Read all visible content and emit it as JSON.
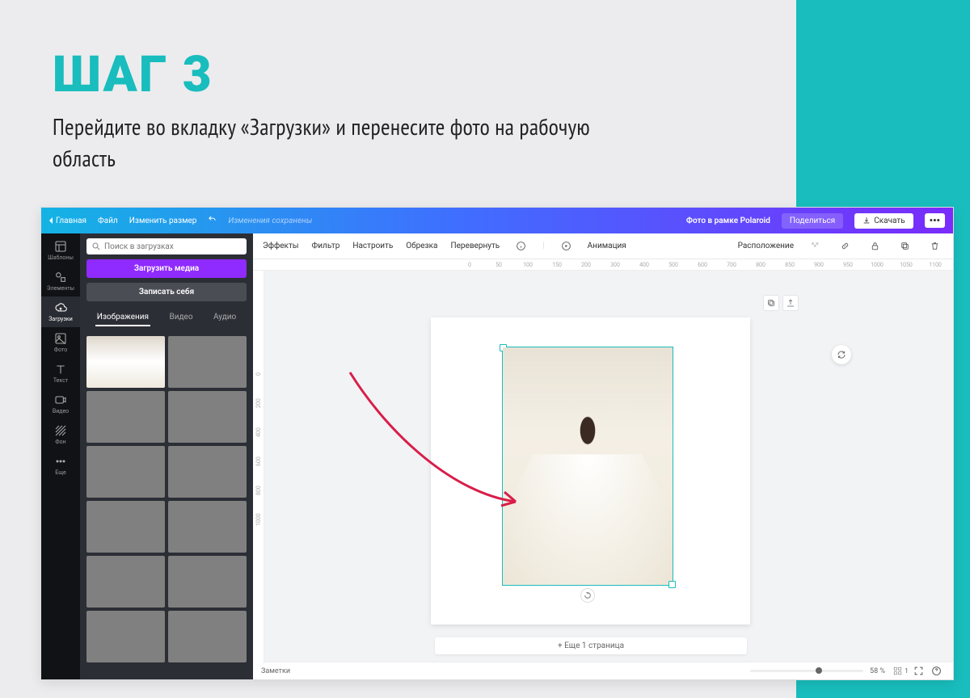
{
  "step": {
    "title": "ШАГ 3",
    "desc": "Перейдите во вкладку «Загрузки» и перенесите фото на рабочую область"
  },
  "topbar": {
    "home": "Главная",
    "file": "Файл",
    "resize": "Изменить размер",
    "saved": "Изменения сохранены",
    "doc_name": "Фото в рамке Polaroid",
    "share": "Поделиться",
    "download": "Скачать"
  },
  "rail": {
    "templates": "Шаблоны",
    "elements": "Элементы",
    "uploads": "Загрузки",
    "photo": "Фото",
    "text": "Текст",
    "video": "Видео",
    "bg": "Фон",
    "more": "Еще"
  },
  "panel": {
    "search_placeholder": "Поиск в загрузках",
    "upload_btn": "Загрузить медиа",
    "record_btn": "Записать себя",
    "tab_images": "Изображения",
    "tab_video": "Видео",
    "tab_audio": "Аудио"
  },
  "tools": {
    "effects": "Эффекты",
    "filter": "Фильтр",
    "adjust": "Настроить",
    "crop": "Обрезка",
    "flip": "Перевернуть",
    "animation": "Анимация",
    "position": "Расположение"
  },
  "ruler_h": [
    "0",
    "50",
    "100",
    "150",
    "200",
    "300",
    "400",
    "500",
    "600",
    "700",
    "800",
    "850",
    "900",
    "950",
    "1000",
    "1050",
    "1100"
  ],
  "ruler_v": [
    "0",
    "200",
    "400",
    "600",
    "800",
    "1000"
  ],
  "add_page": "+ Еще 1 страница",
  "footer": {
    "notes": "Заметки",
    "zoom_label": "58 %",
    "page_label": "1"
  }
}
